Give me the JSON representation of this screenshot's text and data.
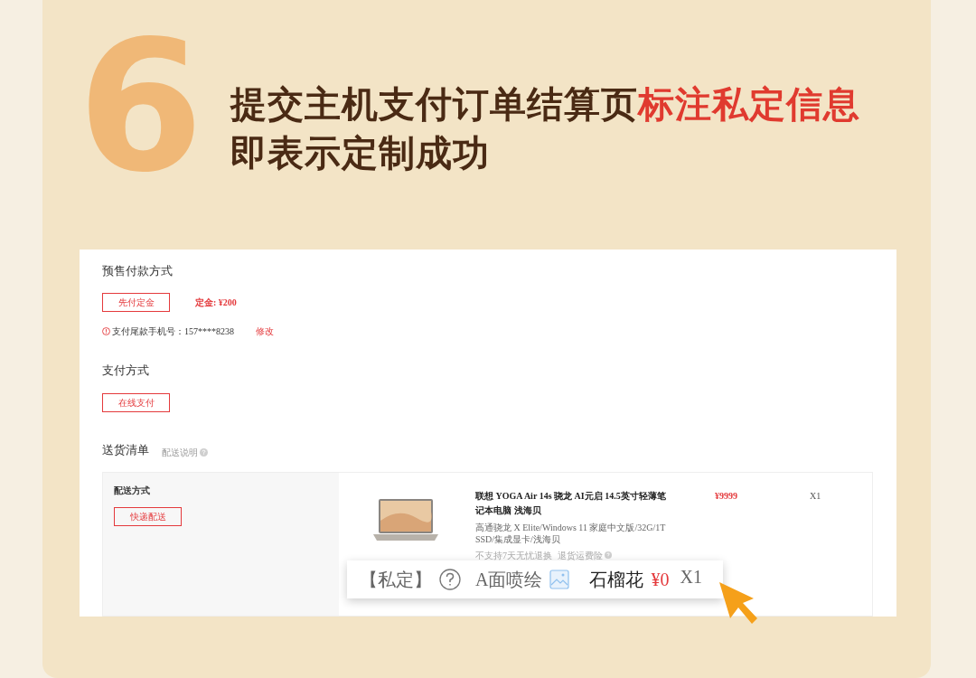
{
  "step_number": "6",
  "headline": {
    "text": "提交主机支付订单结算页",
    "highlight": "标注私定信息",
    "line_2": "即表示定制成功"
  },
  "presale": {
    "title": "预售付款方式",
    "option": {
      "label": "先付定金",
      "selected": true
    },
    "deposit": "定金: ¥200",
    "phone_label": "支付尾款手机号：157****8238",
    "edit_link": "修改"
  },
  "payment": {
    "title": "支付方式",
    "option": {
      "label": "在线支付",
      "selected": true
    }
  },
  "delivery": {
    "title": "送货清单",
    "note": "配送说明",
    "method_label": "配送方式",
    "method": {
      "label": "快递配送",
      "selected": true
    }
  },
  "product": {
    "name": "联想 YOGA Air 14s 骁龙 AI元启 14.5英寸轻薄笔记本电脑 浅海贝",
    "specs": "高通骁龙 X Elite/Windows 11 家庭中文版/32G/1T SSD/集成显卡/浅海贝",
    "return_policy": "不支持7天无忧退换",
    "insurance": "退货运费险",
    "price": "¥9999",
    "quantity": "X1"
  },
  "custom": {
    "tag": "【私定】",
    "side": "A面喷绘",
    "pattern": "石榴花",
    "price": "¥0",
    "quantity": "X1"
  }
}
